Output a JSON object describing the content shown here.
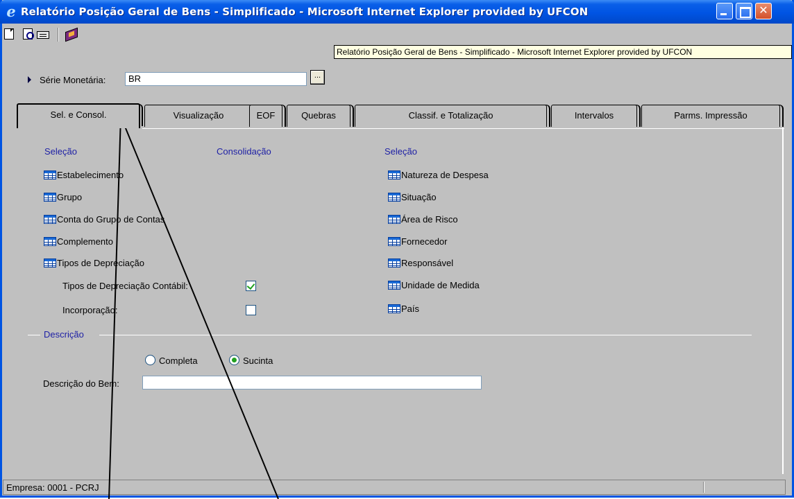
{
  "window": {
    "title": "Relatório Posição Geral de Bens - Simplificado - Microsoft Internet Explorer provided by UFCON"
  },
  "toolbar": {
    "tooltip": "Relatório Posição Geral de Bens - Simplificado - Microsoft Internet Explorer provided by UFCON"
  },
  "serie": {
    "label": "Série Monetária:",
    "value": "BR",
    "lookup_button": "..."
  },
  "tabs": [
    {
      "label": "Sel. e Consol."
    },
    {
      "label": "Visualização"
    },
    {
      "label": "EOF"
    },
    {
      "label": "Quebras"
    },
    {
      "label": "Classif. e Totalização"
    },
    {
      "label": "Intervalos"
    },
    {
      "label": "Parms. Impressão"
    }
  ],
  "selection_left": {
    "heading": "Seleção",
    "items": [
      "Estabelecimento",
      "Grupo",
      "Conta do Grupo de Contas",
      "Complemento",
      "Tipos de Depreciação"
    ]
  },
  "consolidation": {
    "heading": "Consolidação"
  },
  "selection_right": {
    "heading": "Seleção",
    "items": [
      "Natureza de Despesa",
      "Situação",
      "Área de Risco",
      "Fornecedor",
      "Responsável",
      "Unidade de Medida",
      "País"
    ]
  },
  "checkboxes": {
    "depreciacao_contabil": {
      "label": "Tipos de Depreciação Contábil:",
      "checked": true
    },
    "incorporacao": {
      "label": "Incorporação:",
      "checked": false
    }
  },
  "descricao": {
    "group_label": "Descrição",
    "radio_completa": "Completa",
    "radio_sucinta": "Sucinta",
    "selected": "Sucinta",
    "bem_label": "Descrição do Bem:",
    "bem_value": ""
  },
  "status": {
    "text": "Empresa: 0001 - PCRJ"
  }
}
